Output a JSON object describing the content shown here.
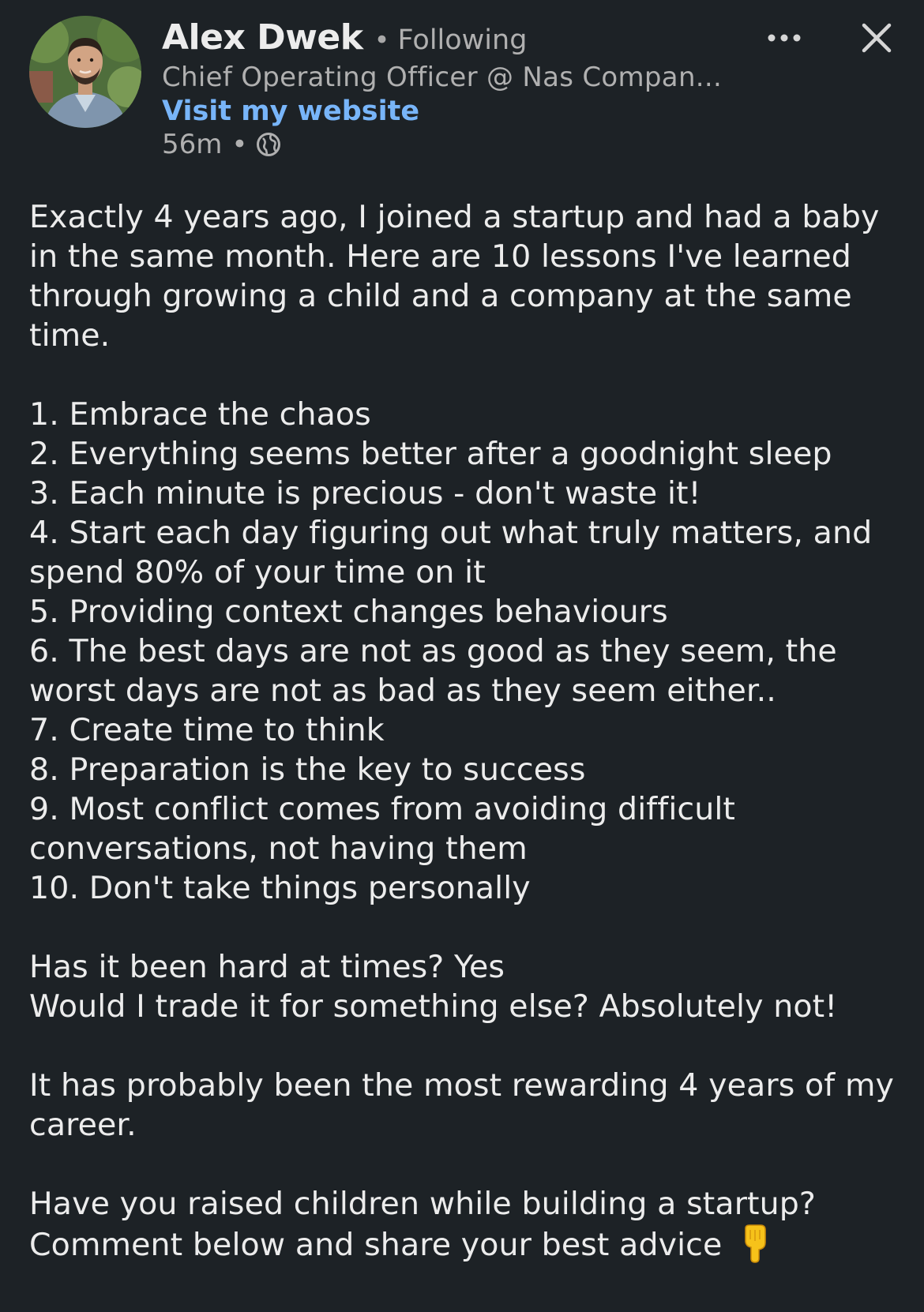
{
  "author": {
    "name": "Alex Dwek",
    "separator": "•",
    "follow_status": "Following",
    "headline": "Chief Operating Officer @ Nas Compan...",
    "website_label": "Visit my website",
    "time_ago": "56m",
    "meta_separator": "•",
    "visibility_icon": "globe-icon",
    "avatar_icon": "profile-photo"
  },
  "actions": {
    "more_icon": "more-horizontal-icon",
    "close_icon": "close-icon"
  },
  "post": {
    "intro_lines": [
      "Exactly 4 years ago, I joined a startup and had a baby",
      "in the same month. Here are 10 lessons I've learned",
      "through growing a child and a company at the same",
      "time."
    ],
    "lessons": [
      [
        "1. Embrace the chaos"
      ],
      [
        "2. Everything seems better after a goodnight sleep"
      ],
      [
        "3. Each minute is precious - don't waste it!"
      ],
      [
        "4. Start each day figuring out what truly matters, and",
        "spend 80% of your time on it"
      ],
      [
        "5. Providing context changes behaviours"
      ],
      [
        "6. The best days are not as good as they seem, the",
        "worst days are not as bad as they seem either.."
      ],
      [
        "7. Create time to think"
      ],
      [
        "8. Preparation is the key to success"
      ],
      [
        "9. Most conflict comes from avoiding difficult",
        "conversations, not having them"
      ],
      [
        "10. Don't take things personally"
      ]
    ],
    "reflection_lines": [
      "Has it been hard at times? Yes",
      "Would I trade it for something else? Absolutely not!"
    ],
    "summary_lines": [
      "It has probably been the most rewarding 4 years of my",
      "career."
    ],
    "cta_lines": [
      "Have you raised children while building a startup?",
      "Comment below and share your best advice"
    ],
    "cta_emoji": "pointing-down-emoji"
  },
  "colors": {
    "background": "#1d2226",
    "text": "#ececec",
    "secondary_text": "#b0b0b0",
    "link": "#78b5f9"
  }
}
